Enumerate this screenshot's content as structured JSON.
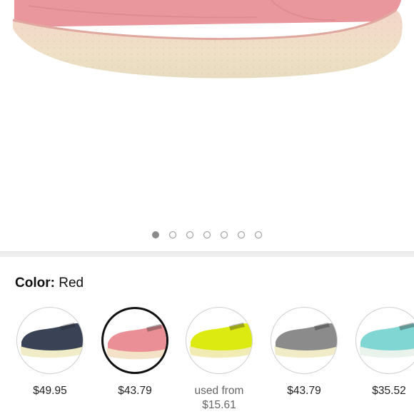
{
  "product": {
    "image_carousel": {
      "total_images": 7,
      "active_index": 0,
      "hero_shoe_color": "#e9979c"
    }
  },
  "color_selector": {
    "label": "Color:",
    "selected_value": "Red",
    "options": [
      {
        "price_line1": "$49.95",
        "price_line2": "",
        "upper_color": "#3a4356",
        "sole_color": "#f1ecc8",
        "selected": false
      },
      {
        "price_line1": "$43.79",
        "price_line2": "",
        "upper_color": "#ea8f95",
        "sole_color": "#f3e2c7",
        "selected": true
      },
      {
        "price_line1": "used from",
        "price_line2": "$15.61",
        "upper_color": "#dcea12",
        "sole_color": "#f1ecb4",
        "selected": false
      },
      {
        "price_line1": "$43.79",
        "price_line2": "",
        "upper_color": "#8b8b8b",
        "sole_color": "#f1ecc8",
        "selected": false
      },
      {
        "price_line1": "$35.52",
        "price_line2": "",
        "upper_color": "#7fd6d2",
        "sole_color": "#eaf2ec",
        "selected": false
      }
    ]
  }
}
